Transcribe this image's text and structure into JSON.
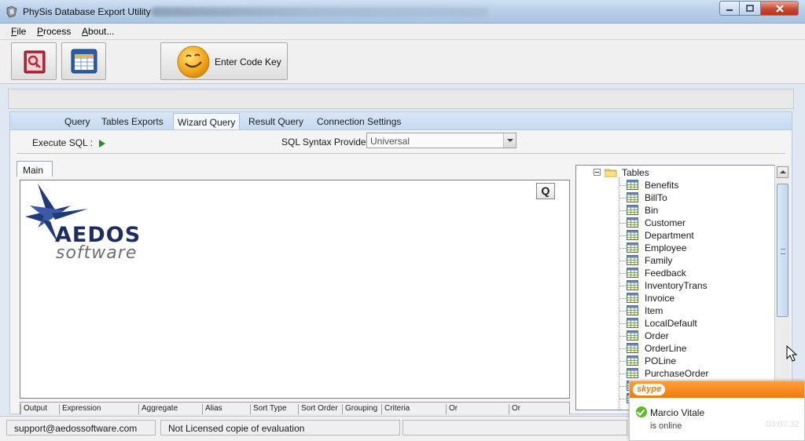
{
  "window": {
    "title": "PhySis Database Export Utility"
  },
  "menu": {
    "items": [
      {
        "accel": "F",
        "rest": "ile"
      },
      {
        "accel": "P",
        "rest": "rocess"
      },
      {
        "accel": "A",
        "rest": "bout..."
      }
    ]
  },
  "toolbar": {
    "enter_code_label": "Enter Code Key"
  },
  "tabs": [
    "Query",
    "Tables Exports",
    "Wizard Query",
    "Result Query",
    "Connection Settings"
  ],
  "active_tab": "Wizard Query",
  "wizard": {
    "execute_label": "Execute SQL :",
    "provider_label": "SQL Syntax Provider:",
    "provider_value": "Universal",
    "main_tab": "Main",
    "q_button": "Q"
  },
  "logo": {
    "title": "AEDOS",
    "subtitle": "software"
  },
  "grid_columns": [
    "Output",
    "Expression",
    "Aggregate",
    "Alias",
    "Sort Type",
    "Sort Order",
    "Grouping",
    "Criteria",
    "Or",
    "Or"
  ],
  "tree": {
    "root": "Tables",
    "items": [
      "Benefits",
      "BillTo",
      "Bin",
      "Customer",
      "Department",
      "Employee",
      "Family",
      "Feedback",
      "InventoryTrans",
      "Invoice",
      "Item",
      "LocalDefault",
      "Order",
      "OrderLine",
      "POLine",
      "PurchaseOrder",
      "",
      ""
    ]
  },
  "status": {
    "email": "support@aedossoftware.com",
    "license": "Not Licensed copie of evaluation"
  },
  "skype": {
    "brand": "skype",
    "contact": "Marcio Vitale",
    "state": "is online",
    "time": "03:07:32"
  },
  "colors": {
    "accent": "#c7daf0",
    "skype_orange": "#f07a0c",
    "logo_navy": "#1d2d5e"
  }
}
